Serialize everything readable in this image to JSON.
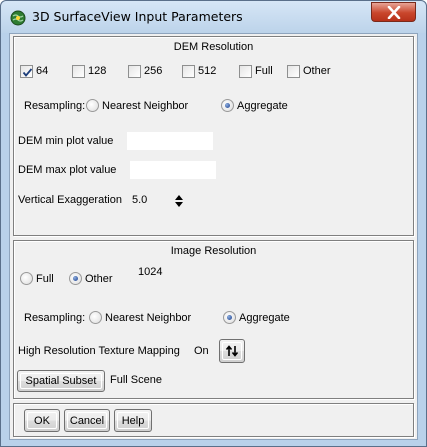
{
  "window": {
    "title": "3D SurfaceView Input Parameters"
  },
  "dem": {
    "heading": "DEM Resolution",
    "resolutions": [
      {
        "label": "64",
        "checked": true
      },
      {
        "label": "128",
        "checked": false
      },
      {
        "label": "256",
        "checked": false
      },
      {
        "label": "512",
        "checked": false
      },
      {
        "label": "Full",
        "checked": false
      },
      {
        "label": "Other",
        "checked": false
      }
    ],
    "resampling_label": "Resampling:",
    "resampling_options": [
      {
        "label": "Nearest Neighbor",
        "selected": false
      },
      {
        "label": "Aggregate",
        "selected": true
      }
    ],
    "min_label": "DEM min plot value",
    "min_value": "",
    "max_label": "DEM max plot value",
    "max_value": "",
    "vexag_label": "Vertical Exaggeration",
    "vexag_value": "5.0"
  },
  "image": {
    "heading": "Image Resolution",
    "resolution_options": [
      {
        "label": "Full",
        "selected": false
      },
      {
        "label": "Other",
        "selected": true
      }
    ],
    "other_value": "1024",
    "resampling_label": "Resampling:",
    "resampling_options": [
      {
        "label": "Nearest Neighbor",
        "selected": false
      },
      {
        "label": "Aggregate",
        "selected": true
      }
    ],
    "texture_label": "High Resolution Texture Mapping",
    "texture_value": "On",
    "subset_button": "Spatial Subset",
    "subset_value": "Full Scene"
  },
  "buttons": {
    "ok": "OK",
    "cancel": "Cancel",
    "help": "Help"
  }
}
